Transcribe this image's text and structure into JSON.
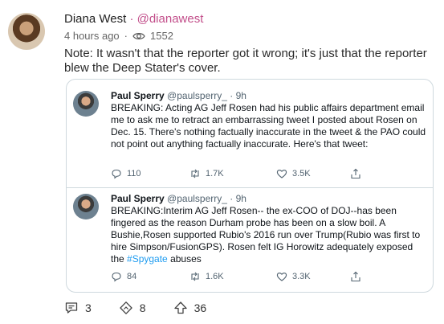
{
  "post": {
    "author": "Diana West",
    "separator": "·",
    "handle": "@dianawest",
    "time": "4 hours ago",
    "meta_separator": "·",
    "views": "1552",
    "body": "Note: It wasn't that the reporter got it wrong; it's just that the reporter blew the Deep Stater's cover."
  },
  "embed": {
    "tweets": [
      {
        "name": "Paul Sperry",
        "handle": "@paulsperry_",
        "sep": "·",
        "time": "9h",
        "text": "BREAKING: Acting AG Jeff Rosen had his public affairs department email me to ask me to retract an embarrassing tweet I posted about Rosen on Dec. 15. There's nothing factually inaccurate in the tweet & the PAO could not point out anything factually inaccurate. Here's that tweet:",
        "replies": "110",
        "retweets": "1.7K",
        "likes": "3.5K"
      },
      {
        "name": "Paul Sperry",
        "handle": "@paulsperry_",
        "sep": "·",
        "time": "9h",
        "text_before": "BREAKING:Interim AG Jeff Rosen-- the ex-COO of DOJ--has been fingered as the reason Durham probe has been on a slow boil. A Bushie,Rosen supported Rubio's 2016 run over Trump(Rubio was first to hire Simpson/FusionGPS). Rosen felt IG Horowitz adequately exposed the ",
        "hashtag": "#Spygate",
        "text_after": " abuses",
        "replies": "84",
        "retweets": "1.6K",
        "likes": "3.3K"
      }
    ]
  },
  "footer": {
    "comments": "3",
    "reposts": "8",
    "upvotes": "36"
  },
  "colors": {
    "accent": "#c24e8a",
    "link": "#1d9bf0",
    "border": "#cfd9de"
  }
}
